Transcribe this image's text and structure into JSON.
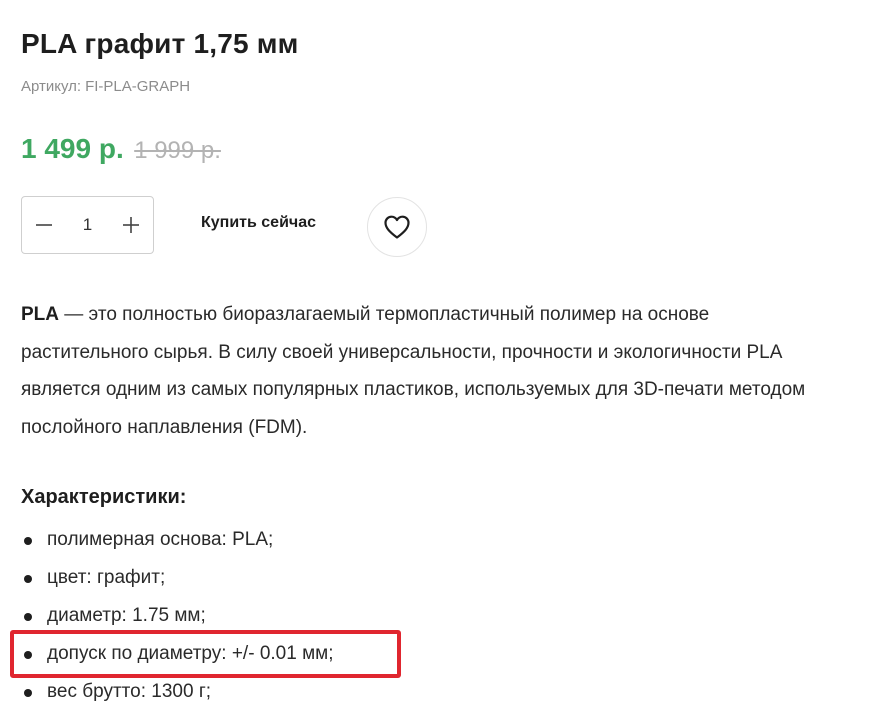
{
  "product": {
    "title": "PLA графит 1,75 мм",
    "sku_label": "Артикул:",
    "sku_value": "FI-PLA-GRAPH"
  },
  "price": {
    "current": "1 499 р.",
    "old": "1 999 р.",
    "accent_color": "#3fa861"
  },
  "cart": {
    "quantity": "1",
    "decrement_icon": "minus-icon",
    "increment_icon": "plus-icon",
    "buy_label": "Купить сейчас",
    "favorite_icon": "heart-icon"
  },
  "description": {
    "lead": "PLA",
    "text": " — это полностью биоразлагаемый термопластичный полимер на основе растительного сырья. В силу своей универсальности, прочности и экологичности PLA является одним из самых популярных пластиков, используемых для 3D-печати методом послойного наплавления (FDM)."
  },
  "specs": {
    "title": "Характеристики:",
    "items": [
      "полимерная основа: PLA;",
      "цвет: графит;",
      "диаметр: 1.75 мм;",
      "допуск по диаметру: +/- 0.01 мм;",
      "вес брутто: 1300 г;"
    ],
    "highlight_color": "#e0262f"
  }
}
